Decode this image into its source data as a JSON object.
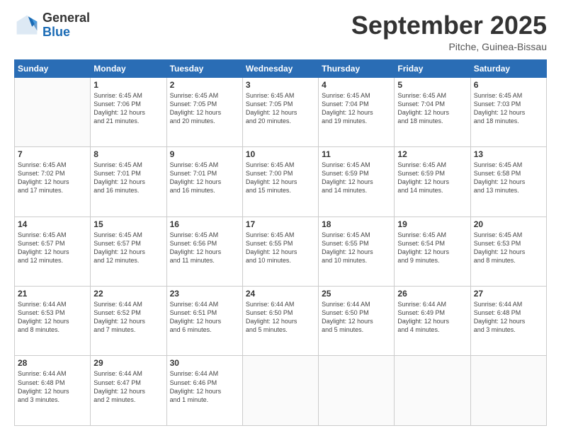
{
  "logo": {
    "general": "General",
    "blue": "Blue"
  },
  "header": {
    "month": "September 2025",
    "location": "Pitche, Guinea-Bissau"
  },
  "weekdays": [
    "Sunday",
    "Monday",
    "Tuesday",
    "Wednesday",
    "Thursday",
    "Friday",
    "Saturday"
  ],
  "weeks": [
    [
      {
        "day": "",
        "info": ""
      },
      {
        "day": "1",
        "info": "Sunrise: 6:45 AM\nSunset: 7:06 PM\nDaylight: 12 hours\nand 21 minutes."
      },
      {
        "day": "2",
        "info": "Sunrise: 6:45 AM\nSunset: 7:05 PM\nDaylight: 12 hours\nand 20 minutes."
      },
      {
        "day": "3",
        "info": "Sunrise: 6:45 AM\nSunset: 7:05 PM\nDaylight: 12 hours\nand 20 minutes."
      },
      {
        "day": "4",
        "info": "Sunrise: 6:45 AM\nSunset: 7:04 PM\nDaylight: 12 hours\nand 19 minutes."
      },
      {
        "day": "5",
        "info": "Sunrise: 6:45 AM\nSunset: 7:04 PM\nDaylight: 12 hours\nand 18 minutes."
      },
      {
        "day": "6",
        "info": "Sunrise: 6:45 AM\nSunset: 7:03 PM\nDaylight: 12 hours\nand 18 minutes."
      }
    ],
    [
      {
        "day": "7",
        "info": "Sunrise: 6:45 AM\nSunset: 7:02 PM\nDaylight: 12 hours\nand 17 minutes."
      },
      {
        "day": "8",
        "info": "Sunrise: 6:45 AM\nSunset: 7:01 PM\nDaylight: 12 hours\nand 16 minutes."
      },
      {
        "day": "9",
        "info": "Sunrise: 6:45 AM\nSunset: 7:01 PM\nDaylight: 12 hours\nand 16 minutes."
      },
      {
        "day": "10",
        "info": "Sunrise: 6:45 AM\nSunset: 7:00 PM\nDaylight: 12 hours\nand 15 minutes."
      },
      {
        "day": "11",
        "info": "Sunrise: 6:45 AM\nSunset: 6:59 PM\nDaylight: 12 hours\nand 14 minutes."
      },
      {
        "day": "12",
        "info": "Sunrise: 6:45 AM\nSunset: 6:59 PM\nDaylight: 12 hours\nand 14 minutes."
      },
      {
        "day": "13",
        "info": "Sunrise: 6:45 AM\nSunset: 6:58 PM\nDaylight: 12 hours\nand 13 minutes."
      }
    ],
    [
      {
        "day": "14",
        "info": "Sunrise: 6:45 AM\nSunset: 6:57 PM\nDaylight: 12 hours\nand 12 minutes."
      },
      {
        "day": "15",
        "info": "Sunrise: 6:45 AM\nSunset: 6:57 PM\nDaylight: 12 hours\nand 12 minutes."
      },
      {
        "day": "16",
        "info": "Sunrise: 6:45 AM\nSunset: 6:56 PM\nDaylight: 12 hours\nand 11 minutes."
      },
      {
        "day": "17",
        "info": "Sunrise: 6:45 AM\nSunset: 6:55 PM\nDaylight: 12 hours\nand 10 minutes."
      },
      {
        "day": "18",
        "info": "Sunrise: 6:45 AM\nSunset: 6:55 PM\nDaylight: 12 hours\nand 10 minutes."
      },
      {
        "day": "19",
        "info": "Sunrise: 6:45 AM\nSunset: 6:54 PM\nDaylight: 12 hours\nand 9 minutes."
      },
      {
        "day": "20",
        "info": "Sunrise: 6:45 AM\nSunset: 6:53 PM\nDaylight: 12 hours\nand 8 minutes."
      }
    ],
    [
      {
        "day": "21",
        "info": "Sunrise: 6:44 AM\nSunset: 6:53 PM\nDaylight: 12 hours\nand 8 minutes."
      },
      {
        "day": "22",
        "info": "Sunrise: 6:44 AM\nSunset: 6:52 PM\nDaylight: 12 hours\nand 7 minutes."
      },
      {
        "day": "23",
        "info": "Sunrise: 6:44 AM\nSunset: 6:51 PM\nDaylight: 12 hours\nand 6 minutes."
      },
      {
        "day": "24",
        "info": "Sunrise: 6:44 AM\nSunset: 6:50 PM\nDaylight: 12 hours\nand 5 minutes."
      },
      {
        "day": "25",
        "info": "Sunrise: 6:44 AM\nSunset: 6:50 PM\nDaylight: 12 hours\nand 5 minutes."
      },
      {
        "day": "26",
        "info": "Sunrise: 6:44 AM\nSunset: 6:49 PM\nDaylight: 12 hours\nand 4 minutes."
      },
      {
        "day": "27",
        "info": "Sunrise: 6:44 AM\nSunset: 6:48 PM\nDaylight: 12 hours\nand 3 minutes."
      }
    ],
    [
      {
        "day": "28",
        "info": "Sunrise: 6:44 AM\nSunset: 6:48 PM\nDaylight: 12 hours\nand 3 minutes."
      },
      {
        "day": "29",
        "info": "Sunrise: 6:44 AM\nSunset: 6:47 PM\nDaylight: 12 hours\nand 2 minutes."
      },
      {
        "day": "30",
        "info": "Sunrise: 6:44 AM\nSunset: 6:46 PM\nDaylight: 12 hours\nand 1 minute."
      },
      {
        "day": "",
        "info": ""
      },
      {
        "day": "",
        "info": ""
      },
      {
        "day": "",
        "info": ""
      },
      {
        "day": "",
        "info": ""
      }
    ]
  ]
}
